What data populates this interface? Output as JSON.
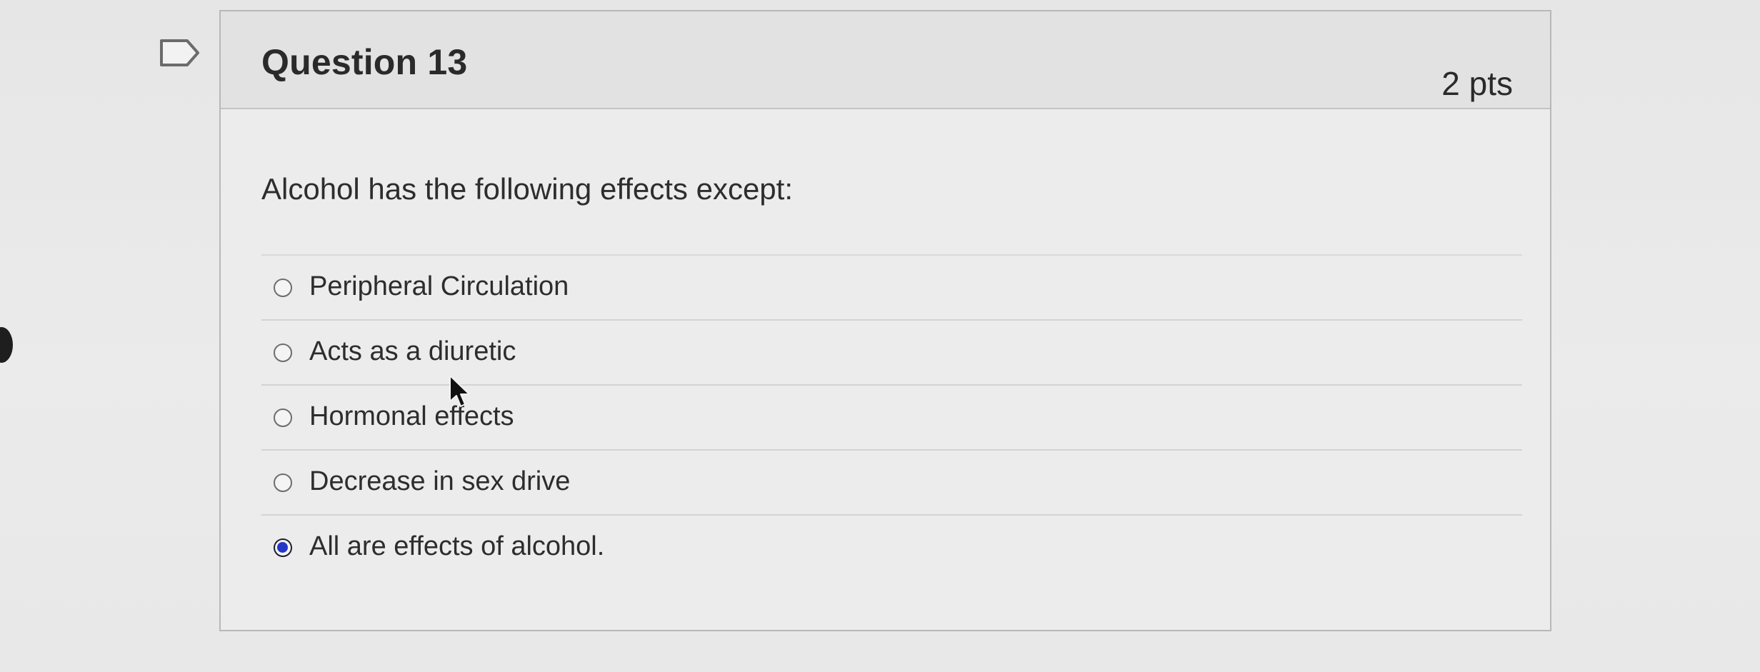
{
  "question": {
    "title": "Question 13",
    "points": "2 pts",
    "prompt": "Alcohol has the following effects except:",
    "answers": [
      {
        "label": "Peripheral Circulation",
        "selected": false
      },
      {
        "label": "Acts as a diuretic",
        "selected": false
      },
      {
        "label": "Hormonal effects",
        "selected": false
      },
      {
        "label": "Decrease in sex drive",
        "selected": false
      },
      {
        "label": "All are effects of alcohol.",
        "selected": true
      }
    ]
  },
  "icons": {
    "flag": "flag-question-icon",
    "cursor": "mouse-pointer-icon",
    "radio_selected_color": "#2437c8"
  }
}
